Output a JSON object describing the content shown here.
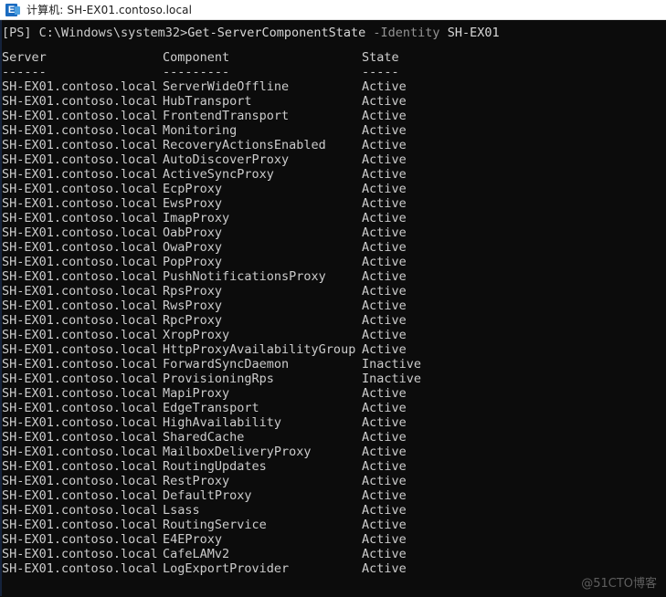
{
  "window": {
    "icon": "exchange-icon",
    "title": "计算机: SH-EX01.contoso.local"
  },
  "console": {
    "prompt": "[PS] C:\\Windows\\system32>",
    "command": "Get-ServerComponentState",
    "parameter": " -Identity",
    "argument": " SH-EX01",
    "colors": {
      "background": "#0c0c0c",
      "foreground": "#cccccc",
      "dim": "#949494",
      "titlebar": "#ffffff"
    },
    "table": {
      "headers": [
        "Server",
        "Component",
        "State"
      ],
      "underlines": [
        "------",
        "---------",
        "-----"
      ],
      "rows": [
        [
          "SH-EX01.contoso.local",
          "ServerWideOffline",
          "Active"
        ],
        [
          "SH-EX01.contoso.local",
          "HubTransport",
          "Active"
        ],
        [
          "SH-EX01.contoso.local",
          "FrontendTransport",
          "Active"
        ],
        [
          "SH-EX01.contoso.local",
          "Monitoring",
          "Active"
        ],
        [
          "SH-EX01.contoso.local",
          "RecoveryActionsEnabled",
          "Active"
        ],
        [
          "SH-EX01.contoso.local",
          "AutoDiscoverProxy",
          "Active"
        ],
        [
          "SH-EX01.contoso.local",
          "ActiveSyncProxy",
          "Active"
        ],
        [
          "SH-EX01.contoso.local",
          "EcpProxy",
          "Active"
        ],
        [
          "SH-EX01.contoso.local",
          "EwsProxy",
          "Active"
        ],
        [
          "SH-EX01.contoso.local",
          "ImapProxy",
          "Active"
        ],
        [
          "SH-EX01.contoso.local",
          "OabProxy",
          "Active"
        ],
        [
          "SH-EX01.contoso.local",
          "OwaProxy",
          "Active"
        ],
        [
          "SH-EX01.contoso.local",
          "PopProxy",
          "Active"
        ],
        [
          "SH-EX01.contoso.local",
          "PushNotificationsProxy",
          "Active"
        ],
        [
          "SH-EX01.contoso.local",
          "RpsProxy",
          "Active"
        ],
        [
          "SH-EX01.contoso.local",
          "RwsProxy",
          "Active"
        ],
        [
          "SH-EX01.contoso.local",
          "RpcProxy",
          "Active"
        ],
        [
          "SH-EX01.contoso.local",
          "XropProxy",
          "Active"
        ],
        [
          "SH-EX01.contoso.local",
          "HttpProxyAvailabilityGroup",
          "Active"
        ],
        [
          "SH-EX01.contoso.local",
          "ForwardSyncDaemon",
          "Inactive"
        ],
        [
          "SH-EX01.contoso.local",
          "ProvisioningRps",
          "Inactive"
        ],
        [
          "SH-EX01.contoso.local",
          "MapiProxy",
          "Active"
        ],
        [
          "SH-EX01.contoso.local",
          "EdgeTransport",
          "Active"
        ],
        [
          "SH-EX01.contoso.local",
          "HighAvailability",
          "Active"
        ],
        [
          "SH-EX01.contoso.local",
          "SharedCache",
          "Active"
        ],
        [
          "SH-EX01.contoso.local",
          "MailboxDeliveryProxy",
          "Active"
        ],
        [
          "SH-EX01.contoso.local",
          "RoutingUpdates",
          "Active"
        ],
        [
          "SH-EX01.contoso.local",
          "RestProxy",
          "Active"
        ],
        [
          "SH-EX01.contoso.local",
          "DefaultProxy",
          "Active"
        ],
        [
          "SH-EX01.contoso.local",
          "Lsass",
          "Active"
        ],
        [
          "SH-EX01.contoso.local",
          "RoutingService",
          "Active"
        ],
        [
          "SH-EX01.contoso.local",
          "E4EProxy",
          "Active"
        ],
        [
          "SH-EX01.contoso.local",
          "CafeLAMv2",
          "Active"
        ],
        [
          "SH-EX01.contoso.local",
          "LogExportProvider",
          "Active"
        ]
      ]
    }
  },
  "watermark": {
    "text": "@51CTO博客"
  }
}
